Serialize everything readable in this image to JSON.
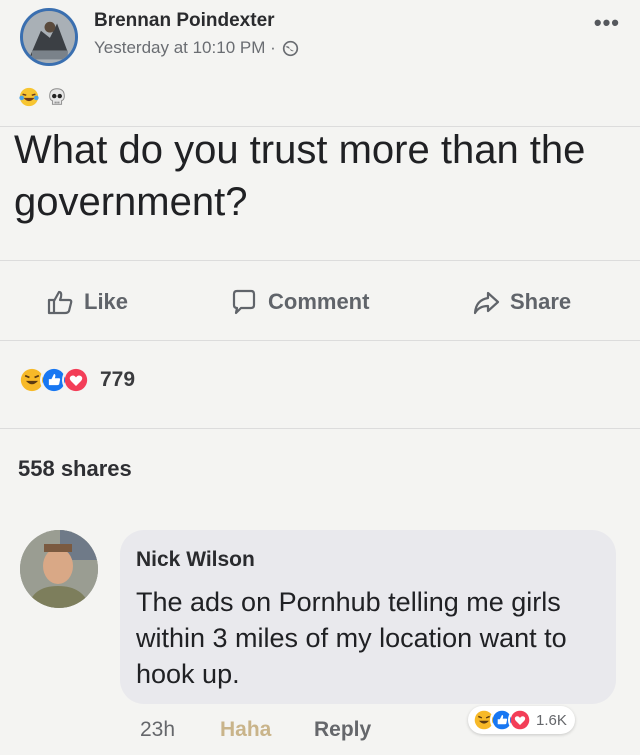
{
  "post": {
    "author": "Brennan Poindexter",
    "timestamp": "Yesterday at 10:10 PM ·",
    "more_icon": "more-options-icon",
    "text": "What do you trust more than the government?"
  },
  "actions": {
    "like": "Like",
    "comment": "Comment",
    "share": "Share"
  },
  "reactions": {
    "count": "779",
    "shares": "558 shares"
  },
  "comment": {
    "author": "Nick Wilson",
    "text": "The ads on Pornhub telling me girls within 3 miles of my location want to hook up.",
    "time": "23h",
    "haha": "Haha",
    "reply": "Reply",
    "reaction_count": "1.6K"
  },
  "colors": {
    "like_blue": "#1877f2",
    "love_red": "#f33e58",
    "haha_yellow": "#f7b928",
    "avatar_ring": "#3a6fb0"
  }
}
